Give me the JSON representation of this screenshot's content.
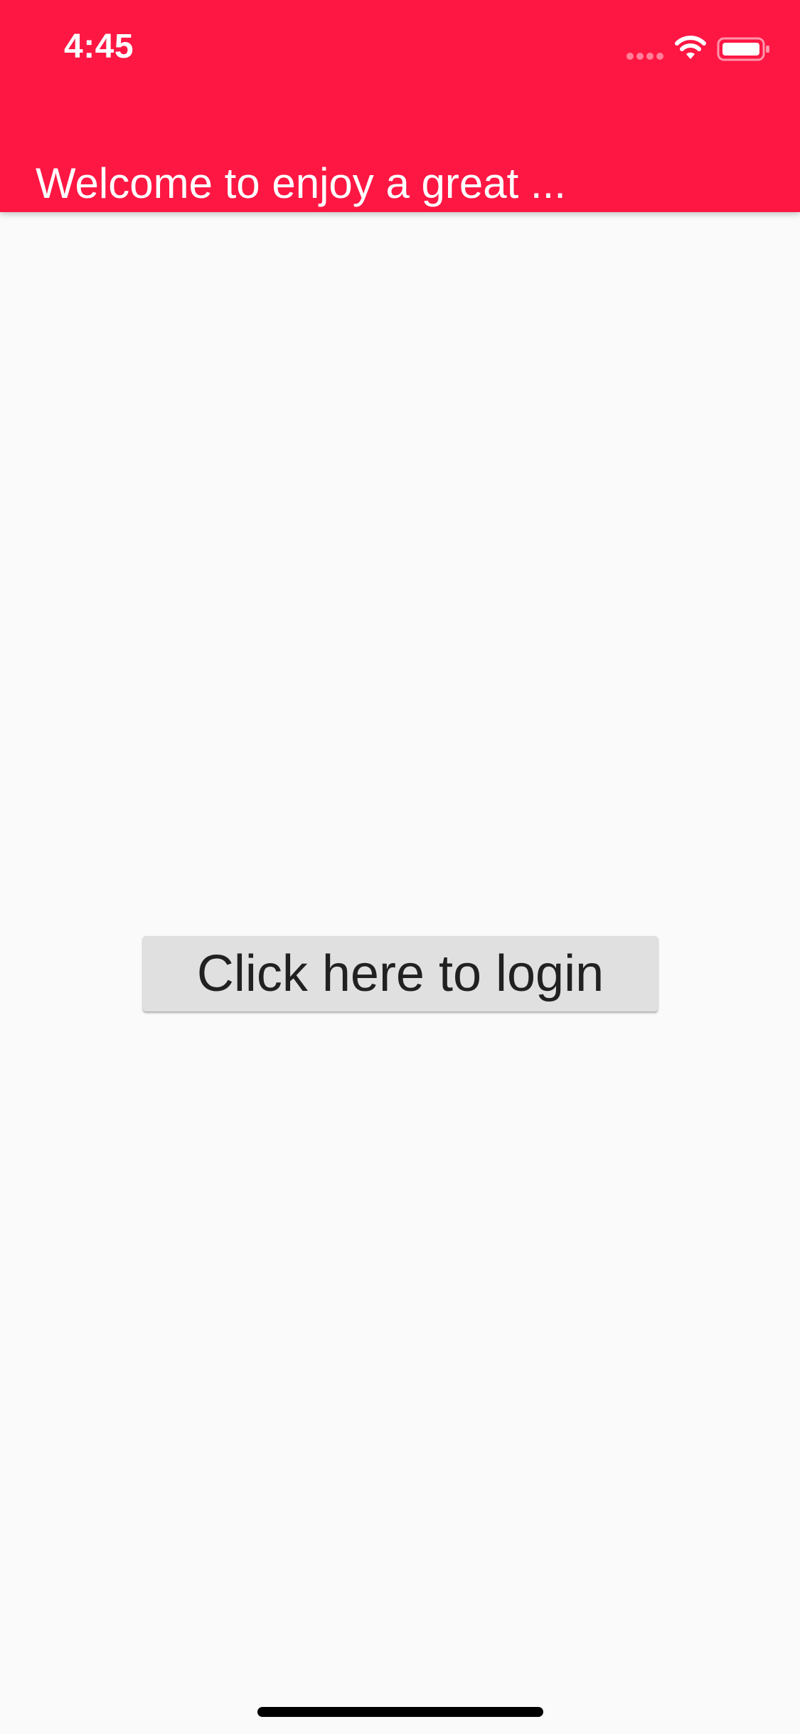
{
  "status_bar": {
    "time": "4:45",
    "signal_icon": "cellular-signal-icon",
    "wifi_icon": "wifi-icon",
    "battery_icon": "battery-icon"
  },
  "app_bar": {
    "title": "Welcome to enjoy a great ...",
    "background_color": "#ff1744"
  },
  "main": {
    "login_button_label": "Click here to login"
  },
  "home_indicator": "home-indicator"
}
